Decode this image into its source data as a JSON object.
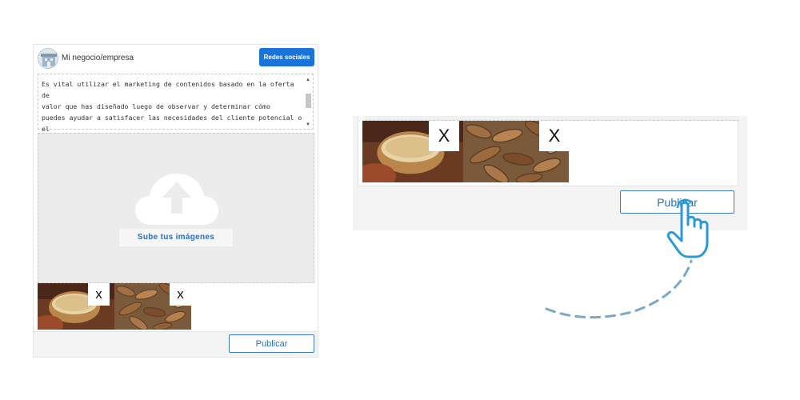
{
  "composer": {
    "business_name": "Mi negocio/empresa",
    "social_button": "Redes sociales",
    "post_text": "Es vital utilizar el marketing de contenidos basado en la oferta de\nvalor que has diseñado luego de observar y determinar cómo\npuedes ayudar a satisfacer las necesidades del cliente potencial o el\nya captado.",
    "upload_label": "Sube tus imágenes",
    "remove_labels": [
      "x",
      "x"
    ],
    "publish_button": "Publicar"
  },
  "zoom": {
    "remove_labels": [
      "X",
      "X"
    ],
    "publish_button": "Publicar"
  },
  "icons": [
    "avatar-icon",
    "cloud-upload-icon",
    "pointer-hand-icon"
  ],
  "colors": {
    "primary": "#1a73d9",
    "link_blue": "#2d6fb8",
    "hand_stroke": "#2a9ad6",
    "arc": "#7aa8c8"
  }
}
